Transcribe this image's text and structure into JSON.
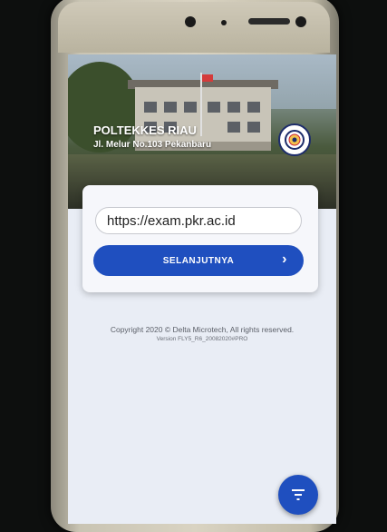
{
  "header": {
    "title": "POLTEKKES RIAU",
    "address": "Jl. Melur No.103 Pekanbaru"
  },
  "form": {
    "url_value": "https://exam.pkr.ac.id",
    "next_label": "SELANJUTNYA",
    "next_icon": "chevron-right-icon"
  },
  "footer": {
    "copyright": "Copyright 2020 © Delta Microtech, All rights reserved.",
    "version": "Version FLY5_R6_20082020#PRO"
  },
  "fab": {
    "icon": "filter-icon"
  },
  "colors": {
    "primary": "#1f4fbf",
    "background": "#e9edf5"
  }
}
